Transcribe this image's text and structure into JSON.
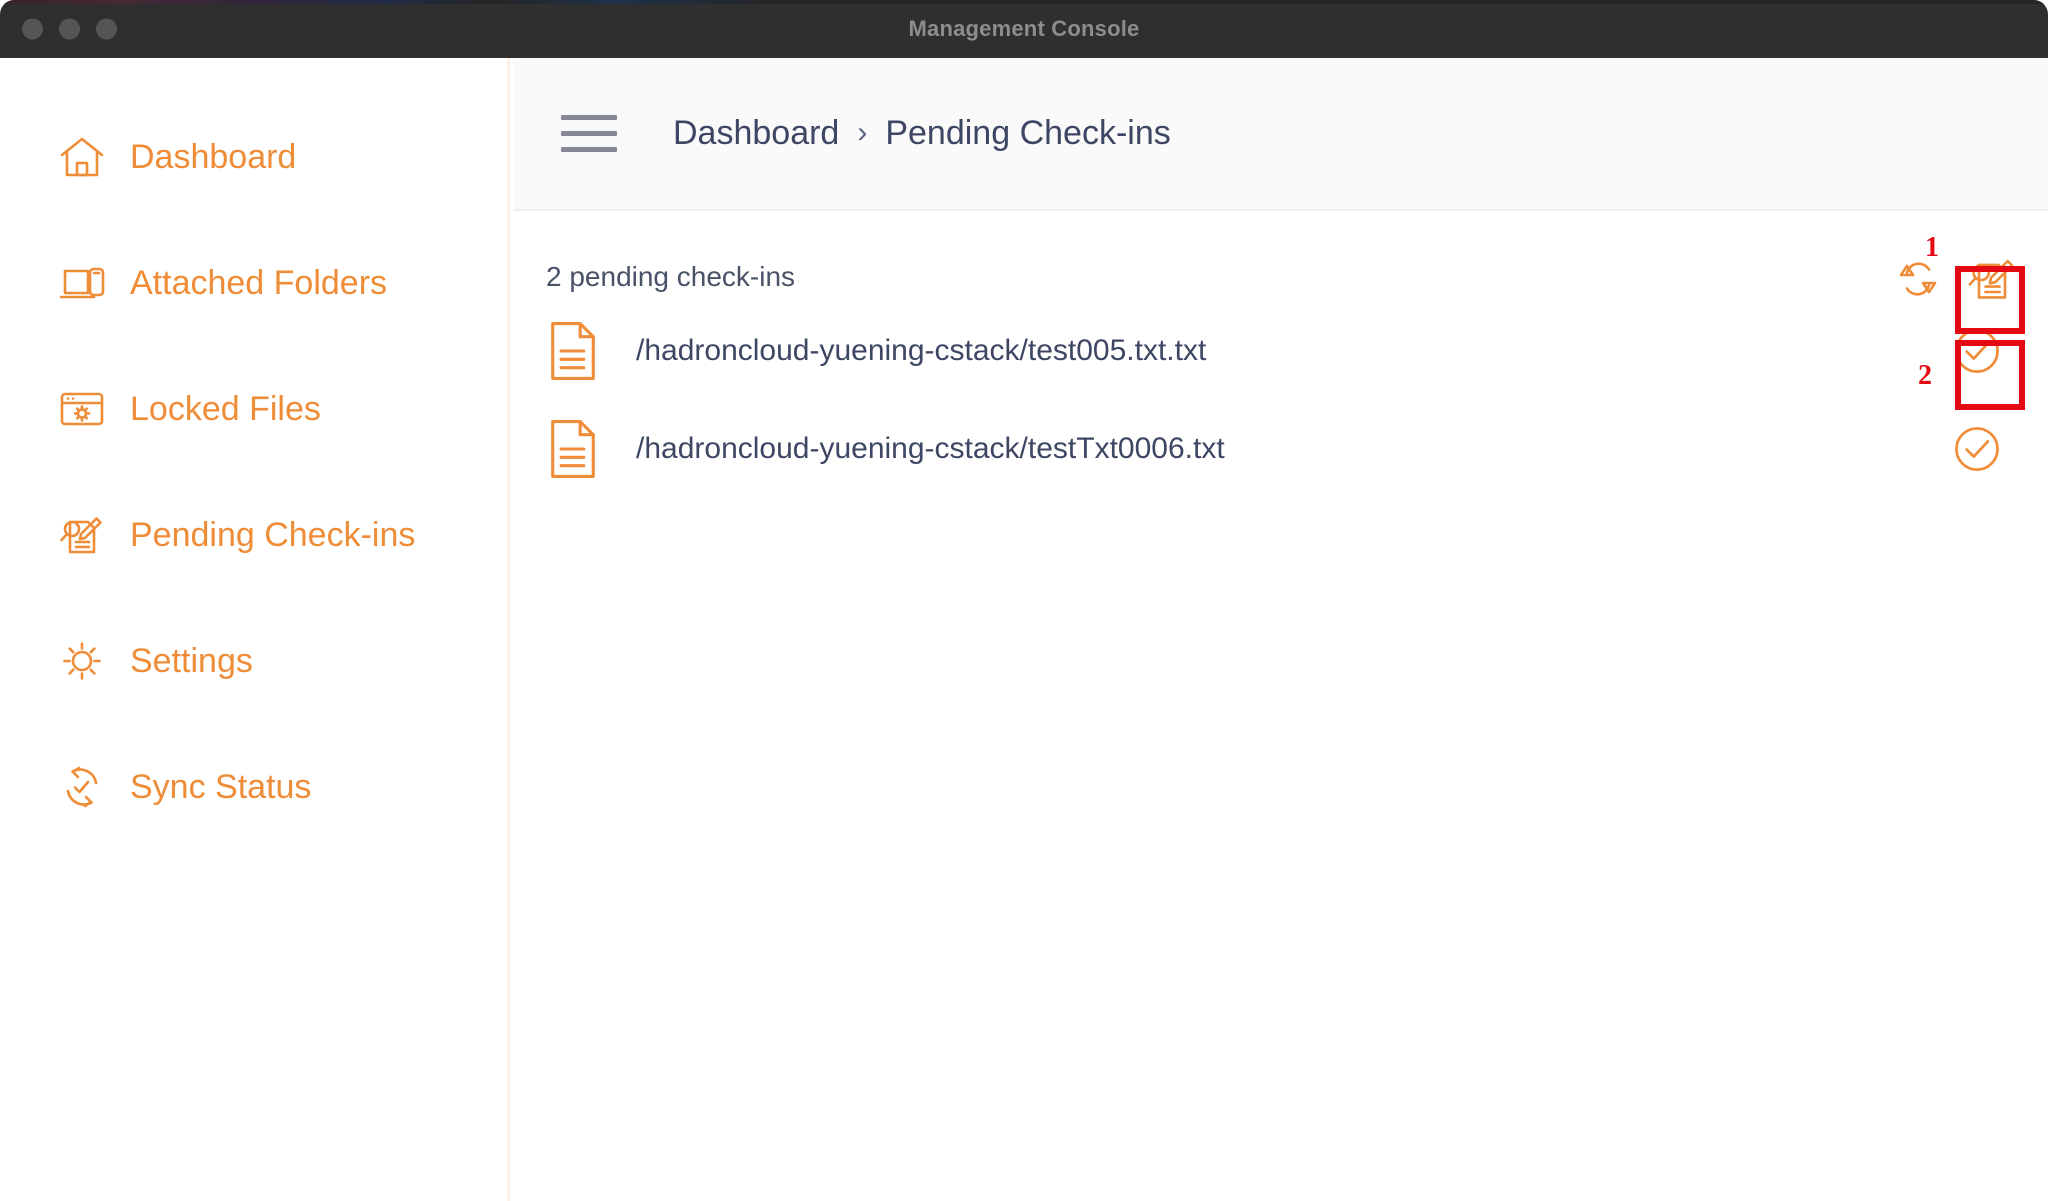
{
  "window": {
    "title": "Management Console",
    "traffic_lights": [
      "close-button",
      "minimize-button",
      "zoom-button"
    ]
  },
  "colors": {
    "accent_orange": "#ef8c37",
    "text_slate": "#3d4663",
    "annotation_red": "#e50914",
    "titlebar": "#2f2f2f",
    "topbar_bg": "#fafafa",
    "divider": "#fdf0e5"
  },
  "sidebar": {
    "items": [
      {
        "label": "Dashboard",
        "icon": "home-icon",
        "active": false
      },
      {
        "label": "Attached Folders",
        "icon": "laptop-phone-icon",
        "active": false
      },
      {
        "label": "Locked Files",
        "icon": "window-gear-icon",
        "active": false
      },
      {
        "label": "Pending Check-ins",
        "icon": "document-search-pen-icon",
        "active": true
      },
      {
        "label": "Settings",
        "icon": "gear-icon",
        "active": false
      },
      {
        "label": "Sync Status",
        "icon": "sync-check-icon",
        "active": false
      }
    ]
  },
  "topbar": {
    "menu_icon": "hamburger-icon",
    "breadcrumb": {
      "items": [
        "Dashboard",
        "Pending Check-ins"
      ],
      "separator": "›"
    }
  },
  "content": {
    "count_text": "2 pending check-ins",
    "tools": [
      {
        "name": "refresh-button",
        "icon": "refresh-sync-icon",
        "annotated": false
      },
      {
        "name": "check-in-all-button",
        "icon": "document-search-pen-icon",
        "annotated": true,
        "annotation": "1"
      }
    ],
    "files": [
      {
        "path": "/hadroncloud-yuening-cstack/test005.txt.txt",
        "icon": "text-file-icon",
        "action": "check-in-button",
        "action_icon": "check-circle-icon",
        "annotated": true,
        "annotation": "2"
      },
      {
        "path": "/hadroncloud-yuening-cstack/testTxt0006.txt",
        "icon": "text-file-icon",
        "action": "check-in-button",
        "action_icon": "check-circle-icon",
        "annotated": false,
        "annotation": ""
      }
    ]
  },
  "annotations": [
    {
      "label": "1",
      "target": "check-in-all-button"
    },
    {
      "label": "2",
      "target": "check-in-button-row-1"
    }
  ]
}
